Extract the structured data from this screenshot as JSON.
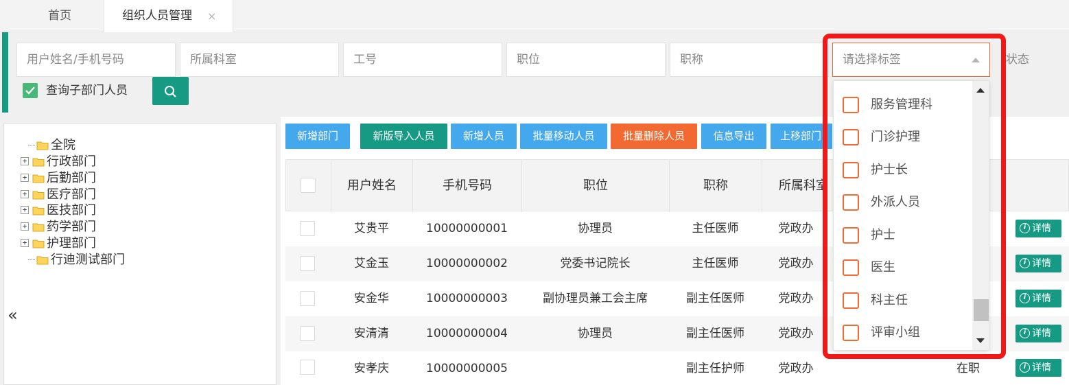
{
  "tabs": {
    "home": "首页",
    "active": "组织人员管理",
    "close_glyph": "×"
  },
  "filters": {
    "name_phone": "用户姓名/手机号码",
    "dept": "所属科室",
    "job_no": "工号",
    "position": "职位",
    "title": "职称",
    "tag_placeholder": "请选择标签",
    "status": "状态",
    "include_sub": "查询子部门人员",
    "include_sub_checked": true
  },
  "tree": {
    "nodes": [
      {
        "label": "全院",
        "expandable": false
      },
      {
        "label": "行政部门",
        "expandable": true
      },
      {
        "label": "后勤部门",
        "expandable": true
      },
      {
        "label": "医疗部门",
        "expandable": true
      },
      {
        "label": "医技部门",
        "expandable": true
      },
      {
        "label": "药学部门",
        "expandable": true
      },
      {
        "label": "护理部门",
        "expandable": true
      },
      {
        "label": "行迪测试部门",
        "expandable": false
      }
    ],
    "collapse_glyph": "«"
  },
  "toolbar": {
    "add_dept": "新增部门",
    "new_import": "新版导入人员",
    "add_user": "新增人员",
    "batch_move": "批量移动人员",
    "batch_delete": "批量删除人员",
    "export": "信息导出",
    "move_up": "上移部门"
  },
  "table": {
    "headers": {
      "name": "用户姓名",
      "phone": "手机号码",
      "position": "职位",
      "title": "职称",
      "dept": "所属科室"
    },
    "rows": [
      {
        "name": "艾贵平",
        "phone": "10000000001",
        "position": "协理员",
        "title": "主任医师",
        "dept": "党政办",
        "status": ""
      },
      {
        "name": "艾金玉",
        "phone": "10000000002",
        "position": "党委书记院长",
        "title": "主任医师",
        "dept": "党政办",
        "status": ""
      },
      {
        "name": "安金华",
        "phone": "10000000003",
        "position": "副协理员兼工会主席",
        "title": "副主任医师",
        "dept": "党政办",
        "status": ""
      },
      {
        "name": "安清清",
        "phone": "10000000004",
        "position": "协理员",
        "title": "副主任医师",
        "dept": "党政办",
        "status": ""
      },
      {
        "name": "安孝庆",
        "phone": "10000000005",
        "position": "",
        "title": "副主任护师",
        "dept": "党政办",
        "status": "在职"
      }
    ],
    "detail_label": "详情",
    "detail_icon_glyph": "i"
  },
  "tag_dropdown": {
    "options": [
      "服务管理科",
      "门诊护理",
      "护士长",
      "外派人员",
      "护士",
      "医生",
      "科主任",
      "评审小组"
    ]
  },
  "colors": {
    "teal": "#169a84",
    "blue": "#44a8ec",
    "orange": "#f26a31",
    "highlight_red": "#f21818",
    "check_green": "#47b879"
  }
}
